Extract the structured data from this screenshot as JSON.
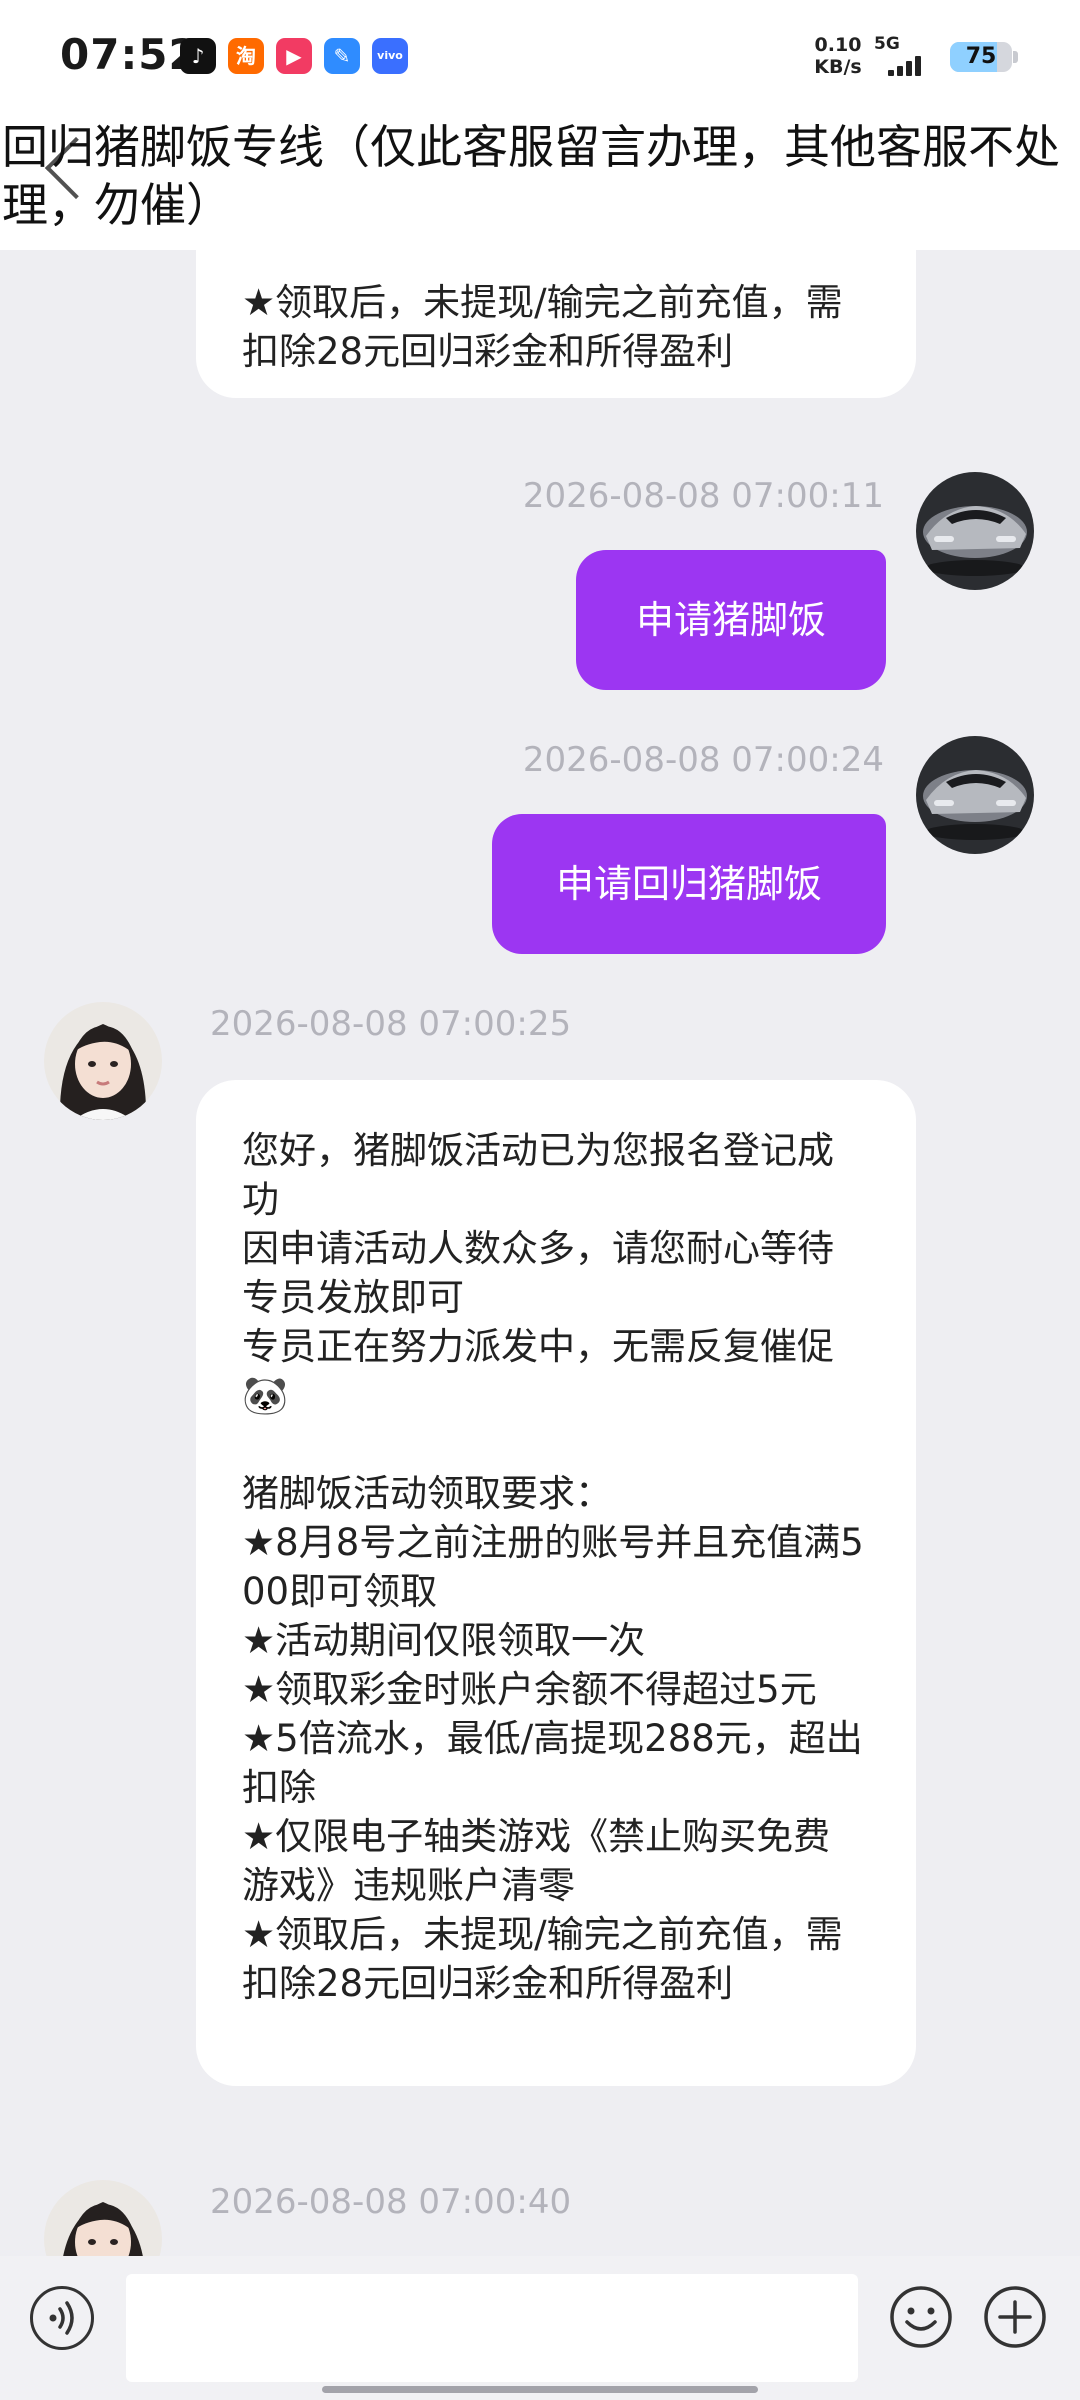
{
  "status_bar": {
    "time": "07:52",
    "apps": [
      {
        "name": "tiktok-icon",
        "glyph": "♪"
      },
      {
        "name": "taobao-icon",
        "glyph": "淘"
      },
      {
        "name": "video-app-icon",
        "glyph": "▶"
      },
      {
        "name": "feather-app-icon",
        "glyph": "✎"
      },
      {
        "name": "vivo-app-icon",
        "glyph": "vivo"
      }
    ],
    "net_speed_value": "0.10",
    "net_speed_unit": "KB/s",
    "network": "5G",
    "battery_level": 75,
    "battery_text": "75"
  },
  "header": {
    "title": "回归猪脚饭专线（仅此客服留言办理，其他客服不处理，勿催）"
  },
  "messages": [
    {
      "sender": "agent",
      "text": "★领取后，未提现/输完之前充值，需扣除28元回归彩金和所得盈利"
    },
    {
      "sender": "user",
      "timestamp": "2026-08-08 07:00:11",
      "text": "申请猪脚饭"
    },
    {
      "sender": "user",
      "timestamp": "2026-08-08 07:00:24",
      "text": "申请回归猪脚饭"
    },
    {
      "sender": "agent",
      "timestamp": "2026-08-08 07:00:25",
      "text": "您好，猪脚饭活动已为您报名登记成功\n因申请活动人数众多，请您耐心等待专员发放即可\n专员正在努力派发中，无需反复催促 🐼\n\n猪脚饭活动领取要求：\n★8月8号之前注册的账号并且充值满500即可领取\n★活动期间仅限领取一次\n★领取彩金时账户余额不得超过5元\n★5倍流水，最低/高提现288元，超出扣除\n★仅限电子轴类游戏《禁止购买免费游戏》违规账户清零\n★领取后，未提现/输完之前充值，需扣除28元回归彩金和所得盈利"
    },
    {
      "sender": "agent",
      "timestamp": "2026-08-08 07:00:40"
    }
  ],
  "input_bar": {
    "placeholder": ""
  },
  "colors": {
    "user_bubble": "#9c36f2",
    "agent_bubble": "#ffffff",
    "chat_background": "#eeeef2",
    "timestamp_text": "#b3b3bb"
  }
}
